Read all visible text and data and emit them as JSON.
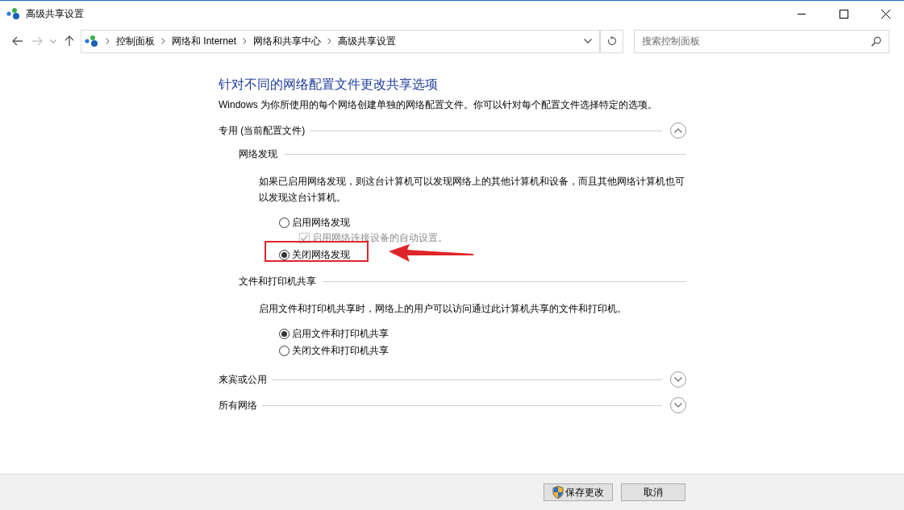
{
  "window": {
    "title": "高级共享设置"
  },
  "breadcrumb": [
    "控制面板",
    "网络和 Internet",
    "网络和共享中心",
    "高级共享设置"
  ],
  "search": {
    "placeholder": "搜索控制面板"
  },
  "heading": "针对不同的网络配置文件更改共享选项",
  "description": "Windows 为你所使用的每个网络创建单独的网络配置文件。你可以针对每个配置文件选择特定的选项。",
  "sections": [
    {
      "title": "专用 (当前配置文件)",
      "expanded": true,
      "groups": [
        {
          "title": "网络发现",
          "description": "如果已启用网络发现，则这台计算机可以发现网络上的其他计算机和设备，而且其他网络计算机也可以发现这台计算机。",
          "options": [
            {
              "kind": "radio",
              "label": "启用网络发现",
              "selected": false,
              "highlighted": false
            },
            {
              "kind": "checkbox",
              "label": "启用网络连接设备的自动设置。",
              "checked": true,
              "disabled": true
            },
            {
              "kind": "radio",
              "label": "关闭网络发现",
              "selected": true,
              "highlighted": true
            }
          ]
        },
        {
          "title": "文件和打印机共享",
          "description": "启用文件和打印机共享时，网络上的用户可以访问通过此计算机共享的文件和打印机。",
          "options": [
            {
              "kind": "radio",
              "label": "启用文件和打印机共享",
              "selected": true,
              "highlighted": false
            },
            {
              "kind": "radio",
              "label": "关闭文件和打印机共享",
              "selected": false,
              "highlighted": false
            }
          ]
        }
      ]
    },
    {
      "title": "来宾或公用",
      "expanded": false
    },
    {
      "title": "所有网络",
      "expanded": false
    }
  ],
  "buttons": [
    {
      "label": "保存更改",
      "kind": "shield"
    },
    {
      "label": "取消",
      "kind": "plain"
    }
  ]
}
